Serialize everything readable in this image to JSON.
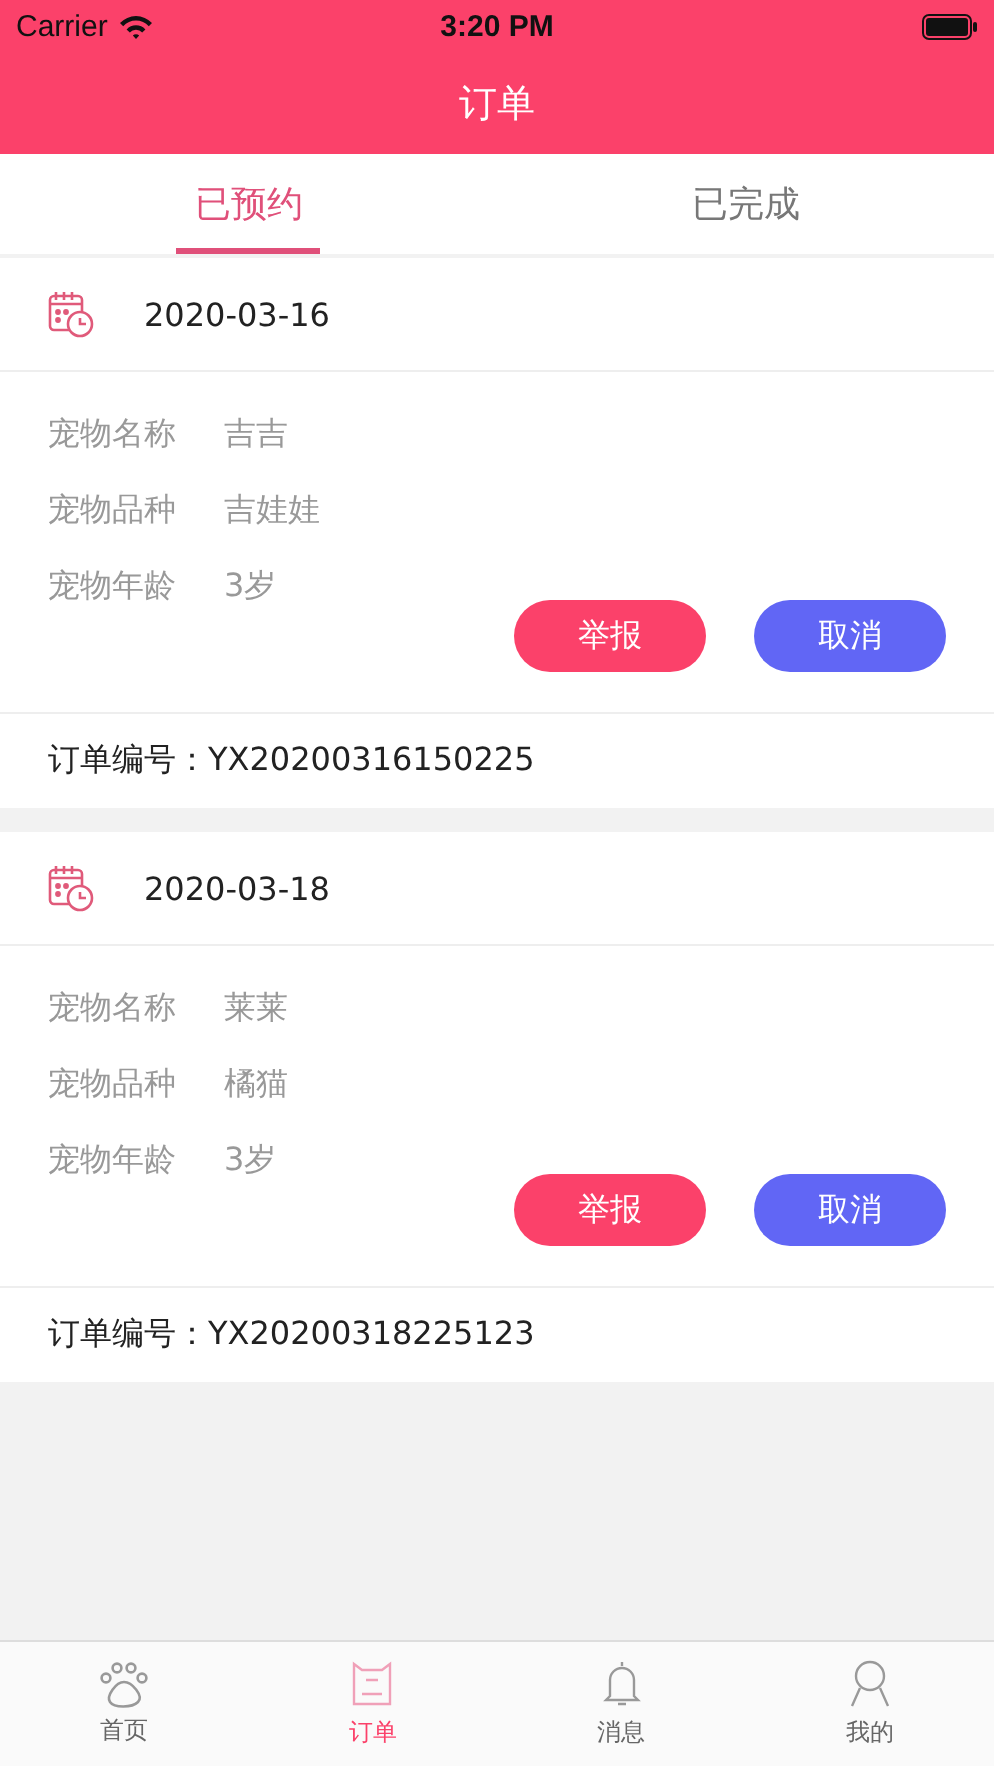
{
  "status_bar": {
    "carrier": "Carrier",
    "time": "3:20 PM"
  },
  "nav": {
    "title": "订单"
  },
  "tabs": [
    {
      "label": "已预约",
      "selected": true
    },
    {
      "label": "已完成",
      "selected": false
    }
  ],
  "orders": [
    {
      "date": "2020-03-16",
      "fields": [
        {
          "label": "宠物名称",
          "value": "吉吉"
        },
        {
          "label": "宠物品种",
          "value": "吉娃娃"
        },
        {
          "label": "宠物年龄",
          "value": "3岁"
        }
      ],
      "buttons": [
        {
          "label": "举报",
          "kind": "report"
        },
        {
          "label": "取消",
          "kind": "cancel"
        }
      ],
      "order_label": "订单编号：",
      "order_no": "YX20200316150225"
    },
    {
      "date": "2020-03-18",
      "fields": [
        {
          "label": "宠物名称",
          "value": "莱莱"
        },
        {
          "label": "宠物品种",
          "value": "橘猫"
        },
        {
          "label": "宠物年龄",
          "value": "3岁"
        }
      ],
      "buttons": [
        {
          "label": "举报",
          "kind": "report"
        },
        {
          "label": "取消",
          "kind": "cancel"
        }
      ],
      "order_label": "订单编号：",
      "order_no": "YX20200318225123"
    }
  ],
  "tab_bar": [
    {
      "label": "首页",
      "selected": false
    },
    {
      "label": "订单",
      "selected": true
    },
    {
      "label": "消息",
      "selected": false
    },
    {
      "label": "我的",
      "selected": false
    }
  ]
}
